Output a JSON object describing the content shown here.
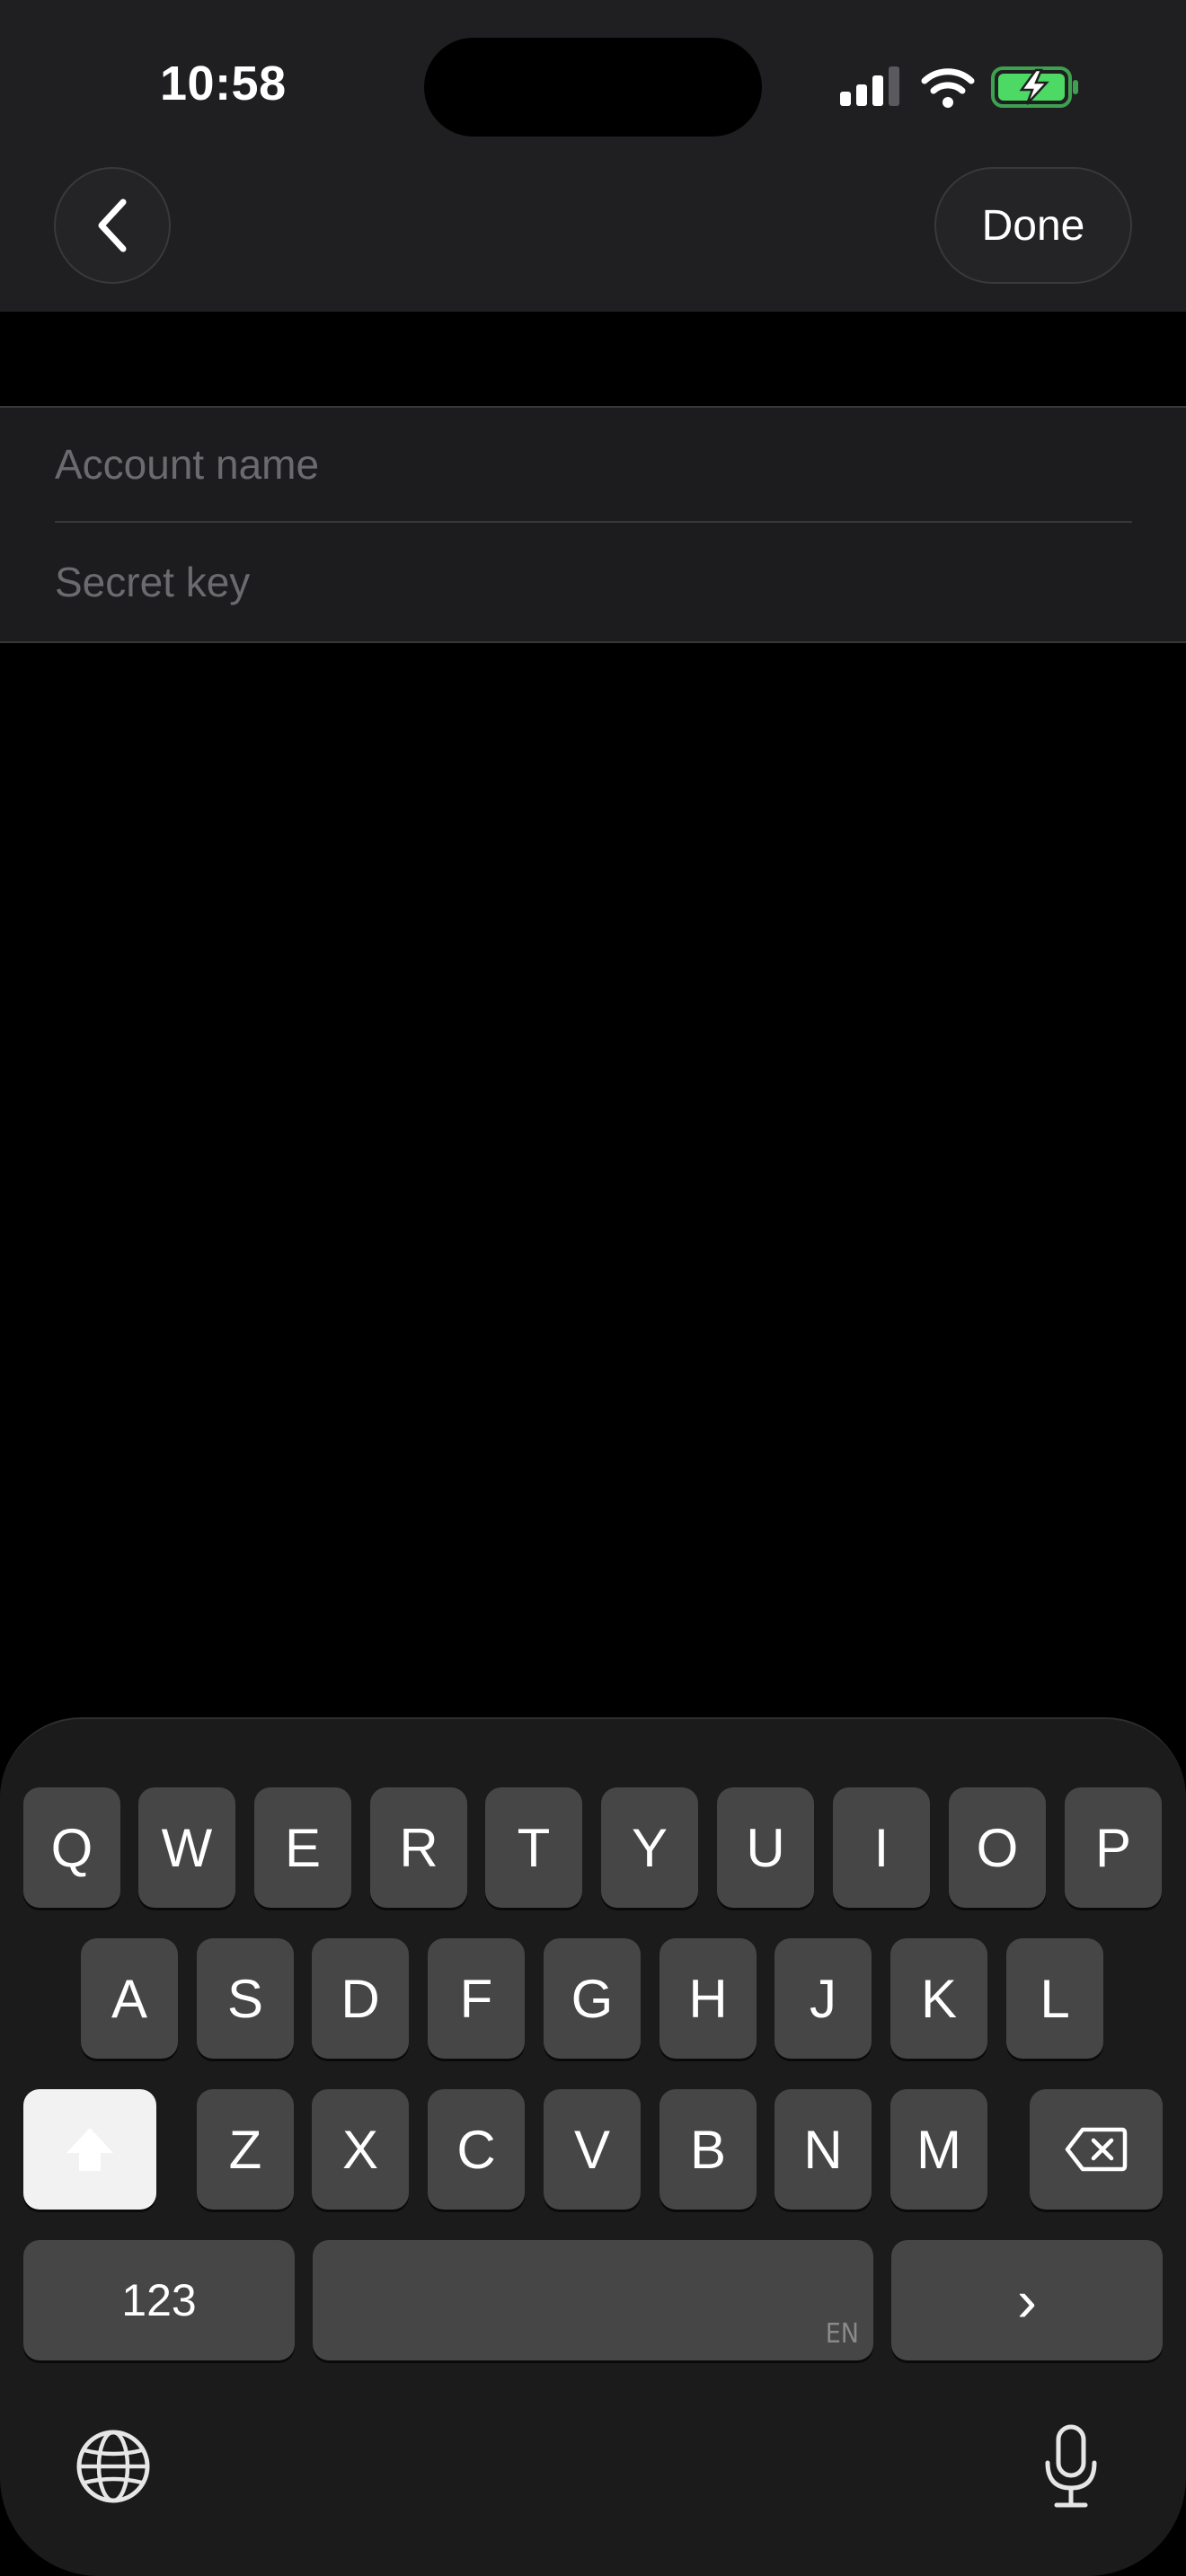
{
  "status_bar": {
    "time": "10:58"
  },
  "nav": {
    "done_label": "Done",
    "back_icon": "chevron-left-icon"
  },
  "form": {
    "account_name_placeholder": "Account name",
    "secret_key_placeholder": "Secret key"
  },
  "keyboard": {
    "row1": [
      "Q",
      "W",
      "E",
      "R",
      "T",
      "Y",
      "U",
      "I",
      "O",
      "P"
    ],
    "row2": [
      "A",
      "S",
      "D",
      "F",
      "G",
      "H",
      "J",
      "K",
      "L"
    ],
    "row3": [
      "Z",
      "X",
      "C",
      "V",
      "B",
      "N",
      "M"
    ],
    "numbers_label": "123",
    "space_language": "EN",
    "next_glyph": "›",
    "icons": [
      "shift-icon",
      "delete-icon",
      "globe-icon",
      "microphone-icon"
    ]
  },
  "colors": {
    "battery_green": "#4cd964",
    "key_bg": "#464646",
    "header_bg": "#1f1f21"
  }
}
